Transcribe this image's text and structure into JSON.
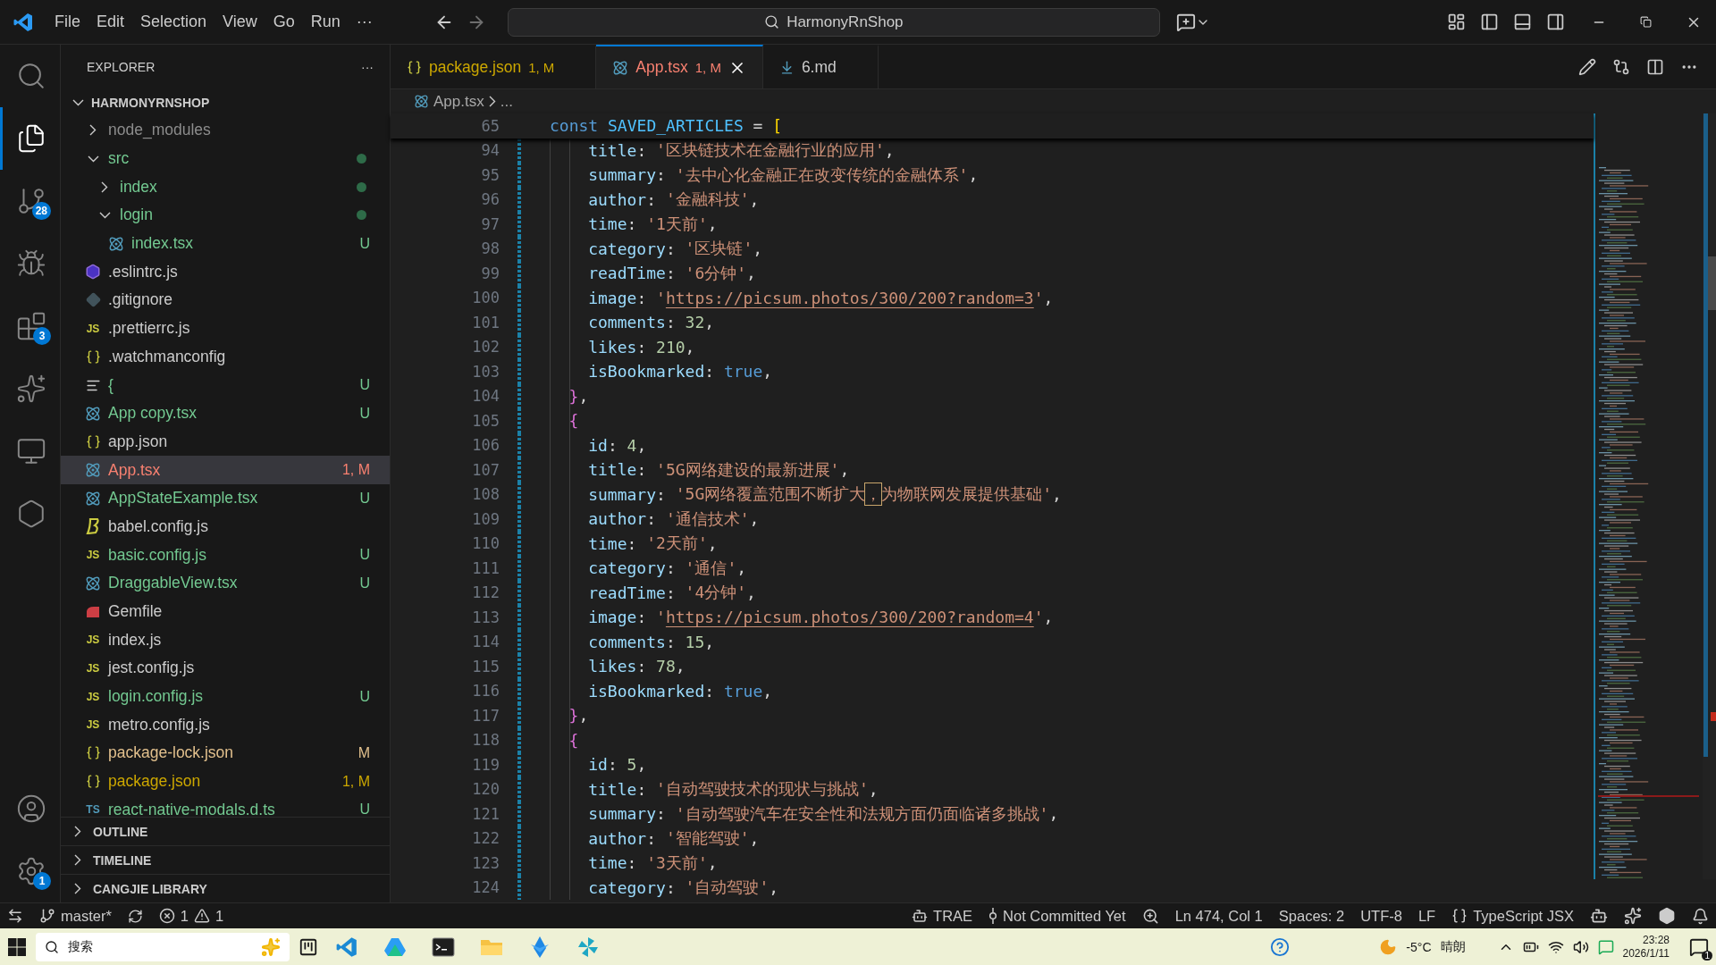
{
  "menu": [
    "File",
    "Edit",
    "Selection",
    "View",
    "Go",
    "Run"
  ],
  "menu_more": "···",
  "command_center": {
    "text": "HarmonyRnShop"
  },
  "activity_bar": [
    {
      "kind": "search",
      "selected": false
    },
    {
      "kind": "explorer",
      "selected": true
    },
    {
      "kind": "source-control",
      "selected": false,
      "badge": "28"
    },
    {
      "kind": "run",
      "selected": false
    },
    {
      "kind": "extensions",
      "selected": false,
      "badge": "3"
    },
    {
      "kind": "star",
      "selected": false
    },
    {
      "kind": "remote",
      "selected": false
    },
    {
      "kind": "hex",
      "selected": false
    }
  ],
  "activity_bottom": [
    {
      "kind": "account"
    },
    {
      "kind": "settings",
      "badge": "1"
    }
  ],
  "sidebar": {
    "title": "EXPLORER",
    "more": "···",
    "root": {
      "label": "HARMONYRNSHOP",
      "expanded": true
    },
    "items": [
      {
        "name": "node_modules",
        "kind": "folder",
        "color": "#8c8c8c",
        "expanded": false,
        "selected": false
      },
      {
        "name": "src",
        "kind": "folder",
        "color": "#73c991",
        "dot": true,
        "expanded": true,
        "selected": false,
        "children": [
          {
            "name": "index",
            "kind": "folder",
            "color": "#73c991",
            "dot": true,
            "expanded": false,
            "selected": false
          },
          {
            "name": "login",
            "kind": "folder",
            "color": "#73c991",
            "dot": true,
            "expanded": true,
            "selected": false,
            "children": [
              {
                "name": "index.tsx",
                "kind": "react",
                "color": "#73c991",
                "badge": "U",
                "selected": false
              }
            ]
          }
        ]
      },
      {
        "name": ".eslintrc.js",
        "kind": "eslint",
        "color": "#cccccc",
        "selected": false
      },
      {
        "name": ".gitignore",
        "kind": "git",
        "color": "#cccccc",
        "selected": false
      },
      {
        "name": ".prettierrc.js",
        "kind": "js",
        "icon_text": "JS",
        "color": "#cccccc",
        "selected": false
      },
      {
        "name": ".watchmanconfig",
        "kind": "json",
        "color": "#cccccc",
        "selected": false
      },
      {
        "name": "{",
        "kind": "text",
        "color": "#73c991",
        "badge": "U",
        "selected": false
      },
      {
        "name": "App copy.tsx",
        "kind": "react",
        "color": "#73c991",
        "badge": "U",
        "selected": false
      },
      {
        "name": "app.json",
        "kind": "json",
        "color": "#cccccc",
        "selected": false
      },
      {
        "name": "App.tsx",
        "kind": "react",
        "color": "#f88070",
        "badge": "1, M",
        "selected": true
      },
      {
        "name": "AppStateExample.tsx",
        "kind": "react",
        "color": "#73c991",
        "badge": "U",
        "selected": false
      },
      {
        "name": "babel.config.js",
        "kind": "babel",
        "color": "#cccccc",
        "selected": false
      },
      {
        "name": "basic.config.js",
        "kind": "js",
        "icon_text": "JS",
        "color": "#73c991",
        "badge": "U",
        "selected": false
      },
      {
        "name": "DraggableView.tsx",
        "kind": "react",
        "color": "#73c991",
        "badge": "U",
        "selected": false
      },
      {
        "name": "Gemfile",
        "kind": "ruby",
        "color": "#cccccc",
        "selected": false
      },
      {
        "name": "index.js",
        "kind": "js",
        "icon_text": "JS",
        "color": "#cccccc",
        "selected": false
      },
      {
        "name": "jest.config.js",
        "kind": "js",
        "icon_text": "JS",
        "color": "#cccccc",
        "selected": false
      },
      {
        "name": "login.config.js",
        "kind": "js",
        "icon_text": "JS",
        "color": "#73c991",
        "badge": "U",
        "selected": false
      },
      {
        "name": "metro.config.js",
        "kind": "js",
        "icon_text": "JS",
        "color": "#cccccc",
        "selected": false
      },
      {
        "name": "package-lock.json",
        "kind": "json",
        "color": "#e2c08d",
        "badge": "M",
        "selected": false
      },
      {
        "name": "package.json",
        "kind": "json",
        "color": "#cca700",
        "badge": "1, M",
        "selected": false
      },
      {
        "name": "react-native-modals.d.ts",
        "kind": "ts",
        "icon_text": "TS",
        "color": "#73c991",
        "badge": "U",
        "selected": false
      }
    ],
    "sections": [
      {
        "label": "OUTLINE",
        "expanded": false
      },
      {
        "label": "TIMELINE",
        "expanded": false
      },
      {
        "label": "CANGJIE LIBRARY",
        "expanded": false
      }
    ]
  },
  "tabs": [
    {
      "label": "package.json",
      "kind": "json",
      "badge": "1, M",
      "color": "#cca700",
      "selected": false
    },
    {
      "label": "App.tsx",
      "kind": "react",
      "badge": "1, M",
      "color": "#f88070",
      "selected": true
    },
    {
      "label": "6.md",
      "kind": "markdown",
      "color": "#cccccc",
      "selected": false
    }
  ],
  "breadcrumb": {
    "file": "App.tsx",
    "rest": "..."
  },
  "sticky_line": {
    "number": "65",
    "tokens": [
      {
        "kind": "kw",
        "text": "const "
      },
      {
        "kind": "const",
        "text": "SAVED_ARTICLES"
      },
      {
        "kind": "punct",
        "text": " = "
      },
      {
        "kind": "bracket",
        "text": "["
      }
    ]
  },
  "lines": [
    {
      "number": "94",
      "kind": "field",
      "tokens": [
        {
          "kind": "prop",
          "text": "title"
        },
        {
          "kind": "punct",
          "text": ": "
        },
        {
          "kind": "string",
          "text": "'区块链技术在金融行业的应用'"
        },
        {
          "kind": "punct",
          "text": ","
        }
      ]
    },
    {
      "number": "95",
      "kind": "field",
      "tokens": [
        {
          "kind": "prop",
          "text": "summary"
        },
        {
          "kind": "punct",
          "text": ": "
        },
        {
          "kind": "string",
          "text": "'去中心化金融正在改变传统的金融体系'"
        },
        {
          "kind": "punct",
          "text": ","
        }
      ]
    },
    {
      "number": "96",
      "kind": "field",
      "tokens": [
        {
          "kind": "prop",
          "text": "author"
        },
        {
          "kind": "punct",
          "text": ": "
        },
        {
          "kind": "string",
          "text": "'金融科技'"
        },
        {
          "kind": "punct",
          "text": ","
        }
      ]
    },
    {
      "number": "97",
      "kind": "field",
      "tokens": [
        {
          "kind": "prop",
          "text": "time"
        },
        {
          "kind": "punct",
          "text": ": "
        },
        {
          "kind": "string",
          "text": "'1天前'"
        },
        {
          "kind": "punct",
          "text": ","
        }
      ]
    },
    {
      "number": "98",
      "kind": "field",
      "tokens": [
        {
          "kind": "prop",
          "text": "category"
        },
        {
          "kind": "punct",
          "text": ": "
        },
        {
          "kind": "string",
          "text": "'区块链'"
        },
        {
          "kind": "punct",
          "text": ","
        }
      ]
    },
    {
      "number": "99",
      "kind": "field",
      "tokens": [
        {
          "kind": "prop",
          "text": "readTime"
        },
        {
          "kind": "punct",
          "text": ": "
        },
        {
          "kind": "string",
          "text": "'6分钟'"
        },
        {
          "kind": "punct",
          "text": ","
        }
      ]
    },
    {
      "number": "100",
      "kind": "field",
      "tokens": [
        {
          "kind": "prop",
          "text": "image"
        },
        {
          "kind": "punct",
          "text": ": "
        },
        {
          "kind": "string",
          "text": "'"
        },
        {
          "kind": "link",
          "text": "https://picsum.photos/300/200?random=3"
        },
        {
          "kind": "string",
          "text": "'"
        },
        {
          "kind": "punct",
          "text": ","
        }
      ]
    },
    {
      "number": "101",
      "kind": "field",
      "tokens": [
        {
          "kind": "prop",
          "text": "comments"
        },
        {
          "kind": "punct",
          "text": ": "
        },
        {
          "kind": "num",
          "text": "32"
        },
        {
          "kind": "punct",
          "text": ","
        }
      ]
    },
    {
      "number": "102",
      "kind": "field",
      "tokens": [
        {
          "kind": "prop",
          "text": "likes"
        },
        {
          "kind": "punct",
          "text": ": "
        },
        {
          "kind": "num",
          "text": "210"
        },
        {
          "kind": "punct",
          "text": ","
        }
      ]
    },
    {
      "number": "103",
      "kind": "field",
      "tokens": [
        {
          "kind": "prop",
          "text": "isBookmarked"
        },
        {
          "kind": "punct",
          "text": ": "
        },
        {
          "kind": "bool",
          "text": "true"
        },
        {
          "kind": "punct",
          "text": ","
        }
      ]
    },
    {
      "number": "104",
      "kind": "brace",
      "tokens": [
        {
          "kind": "brace",
          "text": "}"
        },
        {
          "kind": "punct",
          "text": ","
        }
      ]
    },
    {
      "number": "105",
      "kind": "brace",
      "tokens": [
        {
          "kind": "brace",
          "text": "{"
        }
      ]
    },
    {
      "number": "106",
      "kind": "field",
      "tokens": [
        {
          "kind": "prop",
          "text": "id"
        },
        {
          "kind": "punct",
          "text": ": "
        },
        {
          "kind": "num",
          "text": "4"
        },
        {
          "kind": "punct",
          "text": ","
        }
      ]
    },
    {
      "number": "107",
      "kind": "field",
      "tokens": [
        {
          "kind": "prop",
          "text": "title"
        },
        {
          "kind": "punct",
          "text": ": "
        },
        {
          "kind": "string",
          "text": "'5G网络建设的最新进展'"
        },
        {
          "kind": "punct",
          "text": ","
        }
      ]
    },
    {
      "number": "108",
      "kind": "field",
      "tokens": [
        {
          "kind": "prop",
          "text": "summary"
        },
        {
          "kind": "punct",
          "text": ": "
        },
        {
          "kind": "string",
          "text": "'5G网络覆盖范围不断扩大"
        },
        {
          "kind": "warnchar",
          "text": "，"
        },
        {
          "kind": "string",
          "text": "为物联网发展提供基础'"
        },
        {
          "kind": "punct",
          "text": ","
        }
      ]
    },
    {
      "number": "109",
      "kind": "field",
      "tokens": [
        {
          "kind": "prop",
          "text": "author"
        },
        {
          "kind": "punct",
          "text": ": "
        },
        {
          "kind": "string",
          "text": "'通信技术'"
        },
        {
          "kind": "punct",
          "text": ","
        }
      ]
    },
    {
      "number": "110",
      "kind": "field",
      "tokens": [
        {
          "kind": "prop",
          "text": "time"
        },
        {
          "kind": "punct",
          "text": ": "
        },
        {
          "kind": "string",
          "text": "'2天前'"
        },
        {
          "kind": "punct",
          "text": ","
        }
      ]
    },
    {
      "number": "111",
      "kind": "field",
      "tokens": [
        {
          "kind": "prop",
          "text": "category"
        },
        {
          "kind": "punct",
          "text": ": "
        },
        {
          "kind": "string",
          "text": "'通信'"
        },
        {
          "kind": "punct",
          "text": ","
        }
      ]
    },
    {
      "number": "112",
      "kind": "field",
      "tokens": [
        {
          "kind": "prop",
          "text": "readTime"
        },
        {
          "kind": "punct",
          "text": ": "
        },
        {
          "kind": "string",
          "text": "'4分钟'"
        },
        {
          "kind": "punct",
          "text": ","
        }
      ]
    },
    {
      "number": "113",
      "kind": "field",
      "tokens": [
        {
          "kind": "prop",
          "text": "image"
        },
        {
          "kind": "punct",
          "text": ": "
        },
        {
          "kind": "string",
          "text": "'"
        },
        {
          "kind": "link",
          "text": "https://picsum.photos/300/200?random=4"
        },
        {
          "kind": "string",
          "text": "'"
        },
        {
          "kind": "punct",
          "text": ","
        }
      ]
    },
    {
      "number": "114",
      "kind": "field",
      "tokens": [
        {
          "kind": "prop",
          "text": "comments"
        },
        {
          "kind": "punct",
          "text": ": "
        },
        {
          "kind": "num",
          "text": "15"
        },
        {
          "kind": "punct",
          "text": ","
        }
      ]
    },
    {
      "number": "115",
      "kind": "field",
      "tokens": [
        {
          "kind": "prop",
          "text": "likes"
        },
        {
          "kind": "punct",
          "text": ": "
        },
        {
          "kind": "num",
          "text": "78"
        },
        {
          "kind": "punct",
          "text": ","
        }
      ]
    },
    {
      "number": "116",
      "kind": "field",
      "tokens": [
        {
          "kind": "prop",
          "text": "isBookmarked"
        },
        {
          "kind": "punct",
          "text": ": "
        },
        {
          "kind": "bool",
          "text": "true"
        },
        {
          "kind": "punct",
          "text": ","
        }
      ]
    },
    {
      "number": "117",
      "kind": "brace",
      "tokens": [
        {
          "kind": "brace",
          "text": "}"
        },
        {
          "kind": "punct",
          "text": ","
        }
      ]
    },
    {
      "number": "118",
      "kind": "brace",
      "tokens": [
        {
          "kind": "brace",
          "text": "{"
        }
      ]
    },
    {
      "number": "119",
      "kind": "field",
      "tokens": [
        {
          "kind": "prop",
          "text": "id"
        },
        {
          "kind": "punct",
          "text": ": "
        },
        {
          "kind": "num",
          "text": "5"
        },
        {
          "kind": "punct",
          "text": ","
        }
      ]
    },
    {
      "number": "120",
      "kind": "field",
      "tokens": [
        {
          "kind": "prop",
          "text": "title"
        },
        {
          "kind": "punct",
          "text": ": "
        },
        {
          "kind": "string",
          "text": "'自动驾驶技术的现状与挑战'"
        },
        {
          "kind": "punct",
          "text": ","
        }
      ]
    },
    {
      "number": "121",
      "kind": "field",
      "tokens": [
        {
          "kind": "prop",
          "text": "summary"
        },
        {
          "kind": "punct",
          "text": ": "
        },
        {
          "kind": "string",
          "text": "'自动驾驶汽车在安全性和法规方面仍面临诸多挑战'"
        },
        {
          "kind": "punct",
          "text": ","
        }
      ]
    },
    {
      "number": "122",
      "kind": "field",
      "tokens": [
        {
          "kind": "prop",
          "text": "author"
        },
        {
          "kind": "punct",
          "text": ": "
        },
        {
          "kind": "string",
          "text": "'智能驾驶'"
        },
        {
          "kind": "punct",
          "text": ","
        }
      ]
    },
    {
      "number": "123",
      "kind": "field",
      "tokens": [
        {
          "kind": "prop",
          "text": "time"
        },
        {
          "kind": "punct",
          "text": ": "
        },
        {
          "kind": "string",
          "text": "'3天前'"
        },
        {
          "kind": "punct",
          "text": ","
        }
      ]
    },
    {
      "number": "124",
      "kind": "field",
      "tokens": [
        {
          "kind": "prop",
          "text": "category"
        },
        {
          "kind": "punct",
          "text": ": "
        },
        {
          "kind": "string",
          "text": "'自动驾驶'"
        },
        {
          "kind": "punct",
          "text": ","
        }
      ]
    }
  ],
  "status_bar": {
    "branch": "master*",
    "errors": "1",
    "warnings": "1",
    "items": [
      {
        "kind": "trae",
        "text": "TRAE"
      },
      {
        "kind": "commit",
        "text": "Not Committed Yet"
      },
      {
        "kind": "zoom"
      },
      {
        "kind": "plain",
        "text": "Ln 474, Col 1"
      },
      {
        "kind": "plain",
        "text": "Spaces: 2"
      },
      {
        "kind": "plain",
        "text": "UTF-8"
      },
      {
        "kind": "plain",
        "text": "LF"
      },
      {
        "kind": "language",
        "text": "TypeScript JSX"
      },
      {
        "kind": "copilot"
      },
      {
        "kind": "star"
      },
      {
        "kind": "hex"
      },
      {
        "kind": "bell"
      }
    ]
  },
  "taskbar": {
    "search_placeholder": "搜索",
    "apps": [
      {
        "kind": "vscode"
      },
      {
        "kind": "drive"
      },
      {
        "kind": "terminal"
      },
      {
        "kind": "folder"
      },
      {
        "kind": "bluebird"
      },
      {
        "kind": "pinwheel"
      }
    ],
    "weather": {
      "temp": "-5°C",
      "text": "晴朗"
    },
    "time": "23:28",
    "date": "2026/1/11",
    "notifications": "1"
  }
}
